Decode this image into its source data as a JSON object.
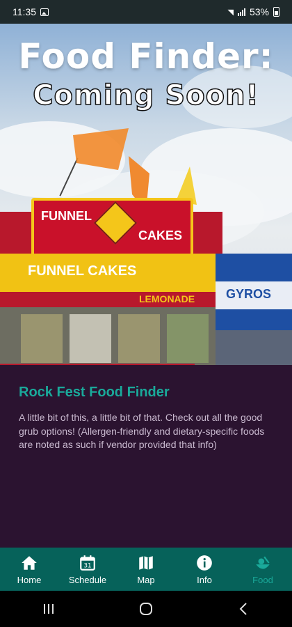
{
  "status_bar": {
    "time": "11:35",
    "battery": "53%"
  },
  "hero": {
    "title": "Food Finder:",
    "subtitle": "Coming Soon!",
    "sign_texts": [
      "FUNNEL",
      "CAKES",
      "FUNNEL CAKES",
      "LEMONADE",
      "GYROS"
    ]
  },
  "content": {
    "heading": "Rock Fest Food Finder",
    "description": "A little bit of this, a little bit of that. Check out all the good grub options! (Allergen-friendly and dietary-specific foods are noted as such if vendor provided that info)"
  },
  "tabs": [
    {
      "label": "Home",
      "icon": "home-icon"
    },
    {
      "label": "Schedule",
      "icon": "calendar-icon"
    },
    {
      "label": "Map",
      "icon": "map-icon"
    },
    {
      "label": "Info",
      "icon": "info-icon"
    },
    {
      "label": "Food",
      "icon": "food-icon",
      "active": true
    }
  ],
  "colors": {
    "accent": "#1aa99a",
    "tabbar": "#06625a",
    "content_bg": "#2b1330",
    "text_muted": "#c9b9cf"
  }
}
